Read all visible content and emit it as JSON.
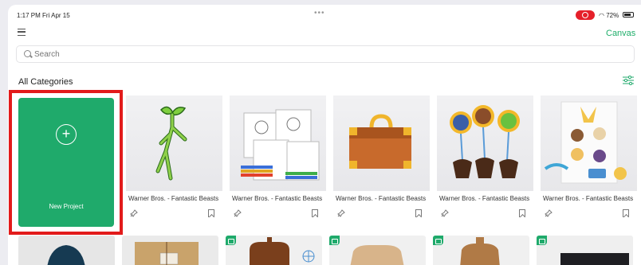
{
  "status_bar": {
    "time": "1:17 PM  Fri Apr 15",
    "dots": "•••",
    "battery_text": "72%"
  },
  "header": {
    "right_link": "Canvas"
  },
  "search": {
    "placeholder": "Search"
  },
  "section": {
    "title": "All Categories"
  },
  "new_project": {
    "label": "New Project"
  },
  "cards": [
    {
      "title": "Warner Bros. - Fantastic Beasts"
    },
    {
      "title": "Warner Bros. - Fantastic Beasts"
    },
    {
      "title": "Warner Bros. - Fantastic Beasts"
    },
    {
      "title": "Warner Bros. - Fantastic Beasts"
    },
    {
      "title": "Warner Bros. - Fantastic Beasts"
    }
  ],
  "colors": {
    "accent_green": "#1faa6b",
    "highlight_red": "#e21b1b",
    "record_red": "#e5202a"
  }
}
